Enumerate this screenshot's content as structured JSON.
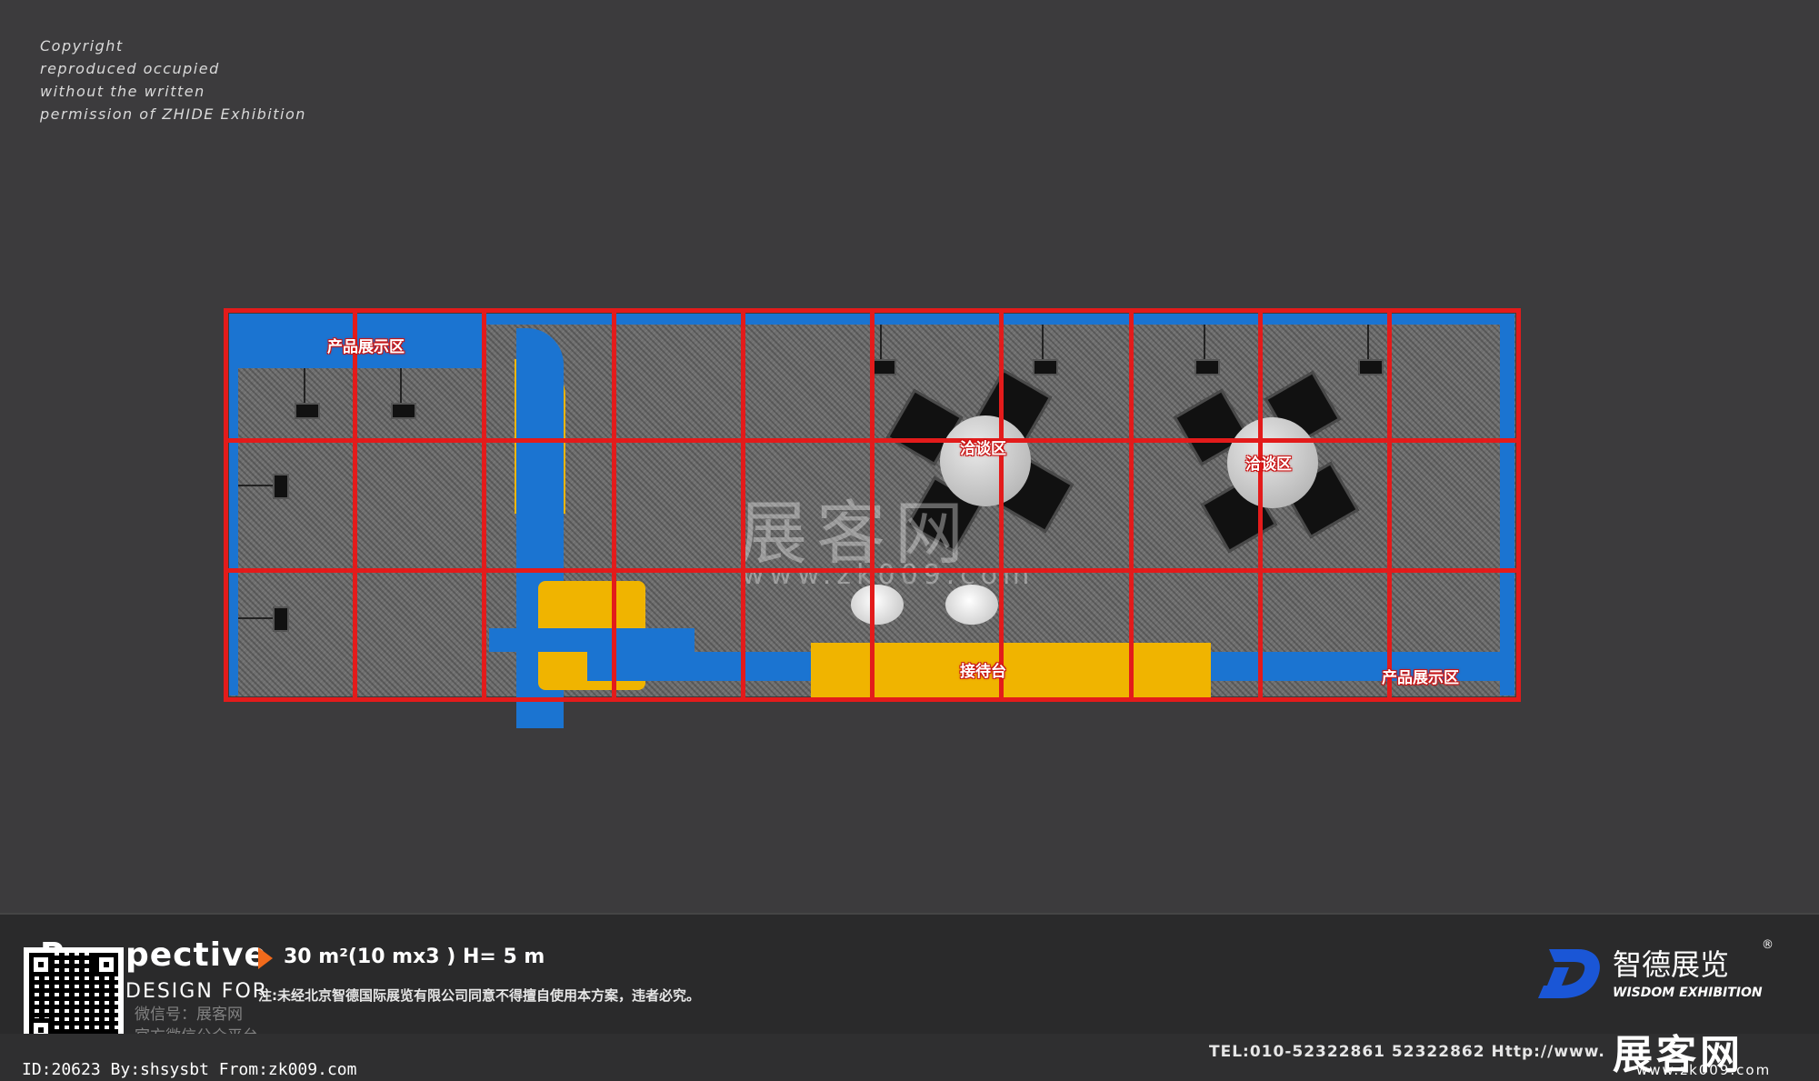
{
  "copyright": [
    "Copyright",
    "reproduced occupied",
    "without the written",
    "permission of ZHIDE Exhibition"
  ],
  "plan": {
    "zones": {
      "product_top": "产品展示区",
      "product_bottom": "产品展示区",
      "negotiation_1": "洽谈区",
      "negotiation_2": "洽谈区",
      "reception": "接待台"
    },
    "watermark_cn": "展客网",
    "watermark_url": "www.zk009.com"
  },
  "footer": {
    "perspective": "Perspective",
    "design_for": "DESIGN FOR",
    "area": "30 m²(10 mx3 ) H= 5 m",
    "notice": "注:未经北京智德国际展览有限公司同意不得擅自使用本方案，违者必究。",
    "wechat_line1": "微信号：展客网",
    "wechat_line2": "官方微信公众平台",
    "brand_cn": "智德展览",
    "brand_en": "WISDOM EXHIBITION",
    "registered": "®",
    "tel": "TEL:010-52322861  52322862   Http://www.",
    "id_line": "ID:20623 By:shsysbt From:zk009.com",
    "site_logo": "展客网",
    "site_url": "www.zk009.com"
  },
  "colors": {
    "background": "#3c3b3d",
    "grid": "#e31b1b",
    "wall_blue": "#1b74d1",
    "counter_yellow": "#f0b400",
    "accent_orange": "#f26a1b"
  }
}
